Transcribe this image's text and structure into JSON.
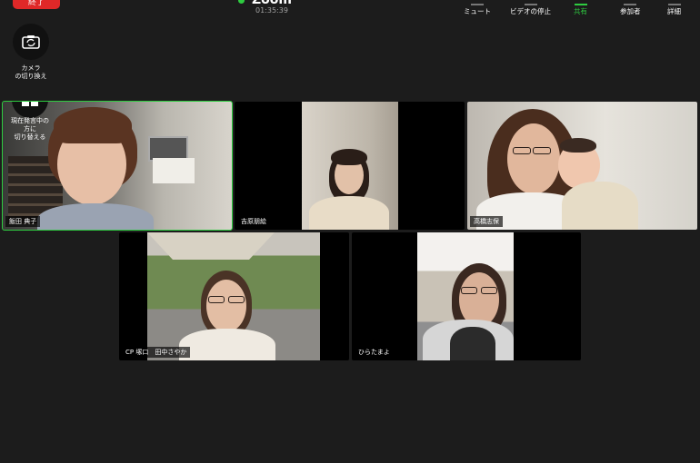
{
  "toolbar": {
    "end_label": "終了",
    "meeting_title": "Zoom",
    "timer": "01:35:39",
    "items": [
      {
        "label": "ミュート",
        "icon": "microphone-icon"
      },
      {
        "label": "ビデオの停止",
        "icon": "video-camera-icon"
      },
      {
        "label": "共有",
        "icon": "share-screen-icon",
        "color": "#2ecc40"
      },
      {
        "label": "参加者",
        "icon": "participants-icon"
      },
      {
        "label": "詳細",
        "icon": "more-icon"
      }
    ]
  },
  "side": {
    "camera_switch_label_line1": "カメラ",
    "camera_switch_label_line2": "の切り換え",
    "view_switch_label_line1": "現在発言中の",
    "view_switch_label_line2": "方に",
    "view_switch_label_line3": "切り替える"
  },
  "participants": [
    {
      "name": "飯田 典子",
      "active": true
    },
    {
      "name": "吉原朋絵"
    },
    {
      "name": "高橋志保"
    },
    {
      "name": "CP 塚口　田中さやか"
    },
    {
      "name": "ひらたまよ"
    }
  ],
  "colors": {
    "active_speaker": "#2ecc40",
    "end_button": "#e02828",
    "background": "#1c1c1c"
  }
}
